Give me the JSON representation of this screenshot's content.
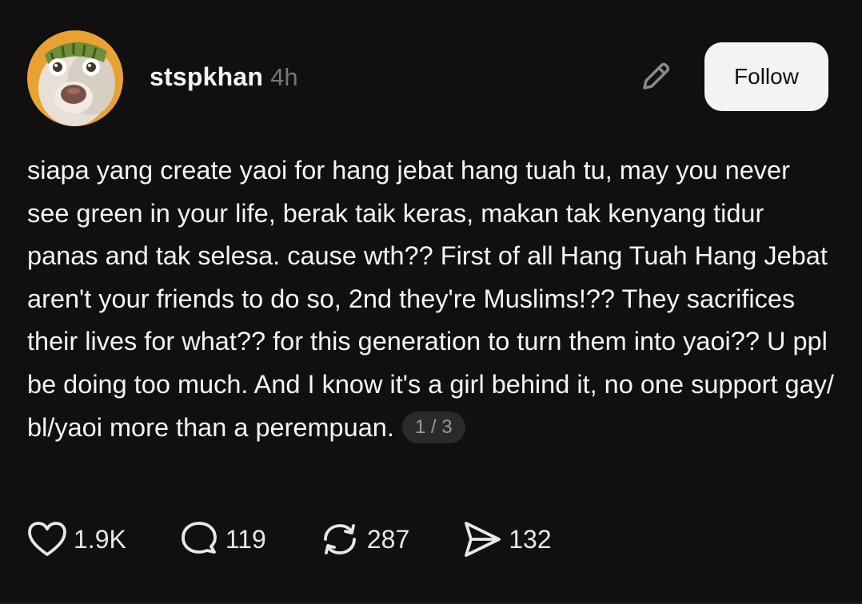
{
  "post": {
    "author": {
      "username": "stspkhan",
      "time": "4h",
      "avatar_icon": "dog-with-melon-hat-avatar"
    },
    "edit_icon": "pencil-icon",
    "follow_label": "Follow",
    "text": "siapa yang create yaoi for hang jebat hang tuah tu, may you never see green in your life, berak taik keras, makan tak kenyang tidur panas and tak selesa. cause wth?? First of all Hang Tuah Hang Jebat aren't your friends to do so, 2nd they're Muslims!?? They sacrifices their lives for what?? for this generation to turn them into yaoi?? U ppl be doing too much. And I know it's a girl behind it, no one support gay/ bl/yaoi more than a perempuan.",
    "pager": "1 / 3",
    "actions": {
      "likes": "1.9K",
      "replies": "119",
      "reposts": "287",
      "shares": "132"
    }
  },
  "colors": {
    "background": "#101010",
    "text": "#f3f5f7",
    "muted": "#777777",
    "follow_bg": "#f3f3f3",
    "pager_bg": "#2a2a2a"
  }
}
